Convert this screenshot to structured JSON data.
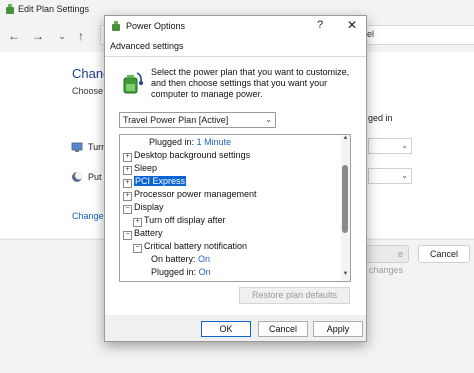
{
  "background_window": {
    "title": "Edit Plan Settings",
    "address_text": "anel",
    "heading": "Change",
    "subtext": "Choose t",
    "turn_label": "Turn",
    "put_label": "Put t",
    "plugged_label": "ged in",
    "change_link": "Change a",
    "save_button": "e changes",
    "cancel_button": "Cancel"
  },
  "dialog": {
    "title": "Power Options",
    "help_label": "?",
    "close_label": "✕",
    "tab_label": "Advanced settings",
    "description": "Select the power plan that you want to customize, and then choose settings that you want your computer to manage power.",
    "plan_select_value": "Travel Power Plan [Active]",
    "tree": [
      {
        "label": "Plugged in:",
        "value": "1 Minute"
      },
      {
        "label": "Desktop background settings",
        "toggle": "+"
      },
      {
        "label": "Sleep",
        "toggle": "+"
      },
      {
        "label": "PCI Express",
        "toggle": "+",
        "selected": true
      },
      {
        "label": "Processor power management",
        "toggle": "+"
      },
      {
        "label": "Display",
        "toggle": "−"
      },
      {
        "label": "Turn off display after",
        "toggle": "+"
      },
      {
        "label": "Battery",
        "toggle": "−"
      },
      {
        "label": "Critical battery notification",
        "toggle": "−"
      },
      {
        "label": "On battery:",
        "value": "On"
      },
      {
        "label": "Plugged in:",
        "value": "On"
      }
    ],
    "restore_button": "Restore plan defaults",
    "ok_button": "OK",
    "cancel_button": "Cancel",
    "apply_button": "Apply"
  },
  "colors": {
    "accent": "#0a64d2",
    "link": "#1e62c8",
    "heading": "#1e3d8f"
  }
}
